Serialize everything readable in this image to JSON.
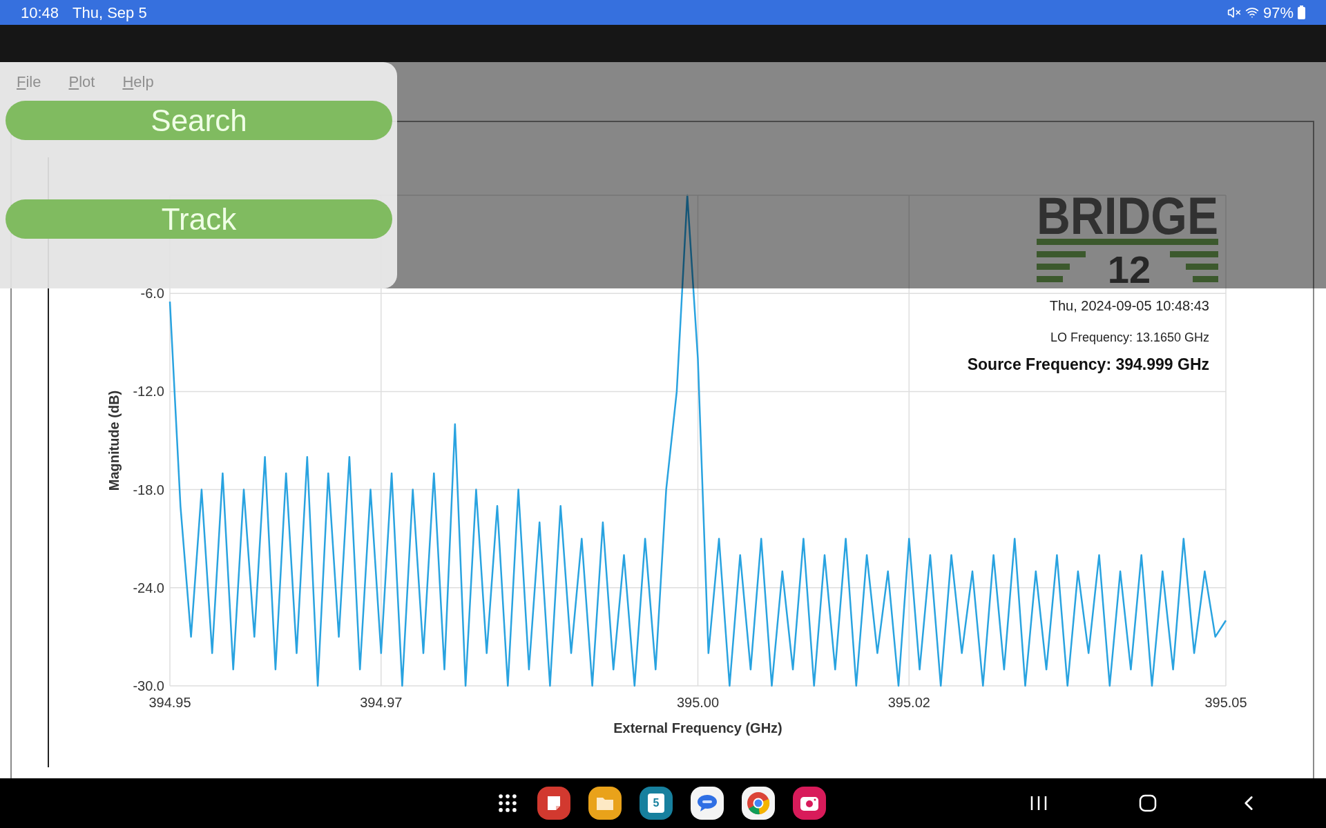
{
  "status_bar": {
    "time": "10:48",
    "date": "Thu, Sep 5",
    "battery": "97%"
  },
  "menu_bar": {
    "items": [
      {
        "label": "File"
      },
      {
        "label": "Plot"
      },
      {
        "label": "Help"
      }
    ]
  },
  "popup": {
    "buttons": [
      {
        "label": "Search"
      },
      {
        "label": "Track"
      }
    ]
  },
  "plot": {
    "logo": {
      "name": "BRIDGE",
      "number": "12"
    },
    "info": {
      "timestamp": "Thu, 2024-09-05 10:48:43",
      "lo_frequency": "LO Frequency: 13.1650 GHz",
      "source_frequency": "Source Frequency: 394.999 GHz"
    },
    "chart_data": {
      "type": "line",
      "grid": true,
      "xlabel": "External Frequency (GHz)",
      "ylabel": "Magnitude (dB)",
      "xlim": [
        394.95,
        395.05
      ],
      "ylim": [
        -30,
        0
      ],
      "x": [
        394.95,
        394.951,
        394.952,
        394.953,
        394.954,
        394.955,
        394.956,
        394.957,
        394.958,
        394.959,
        394.96,
        394.961,
        394.962,
        394.963,
        394.964,
        394.965,
        394.966,
        394.967,
        394.968,
        394.969,
        394.97,
        394.971,
        394.972,
        394.973,
        394.974,
        394.975,
        394.976,
        394.977,
        394.978,
        394.979,
        394.98,
        394.981,
        394.982,
        394.983,
        394.984,
        394.985,
        394.986,
        394.987,
        394.988,
        394.989,
        394.99,
        394.991,
        394.992,
        394.993,
        394.994,
        394.995,
        394.996,
        394.997,
        394.998,
        394.999,
        395.0,
        395.001,
        395.002,
        395.003,
        395.004,
        395.005,
        395.006,
        395.007,
        395.008,
        395.009,
        395.01,
        395.011,
        395.012,
        395.013,
        395.014,
        395.015,
        395.016,
        395.017,
        395.018,
        395.019,
        395.02,
        395.021,
        395.022,
        395.023,
        395.024,
        395.025,
        395.026,
        395.027,
        395.028,
        395.029,
        395.03,
        395.031,
        395.032,
        395.033,
        395.034,
        395.035,
        395.036,
        395.037,
        395.038,
        395.039,
        395.04,
        395.041,
        395.042,
        395.043,
        395.044,
        395.045,
        395.046,
        395.047,
        395.048,
        395.049,
        395.05
      ],
      "xticks": [
        {
          "value": 394.95,
          "label": "394.95"
        },
        {
          "value": 394.97,
          "label": "394.97"
        },
        {
          "value": 395.0,
          "label": "395.00"
        },
        {
          "value": 395.02,
          "label": "395.02"
        },
        {
          "value": 395.05,
          "label": "395.05"
        }
      ],
      "yticks": [
        {
          "value": -6,
          "label": "-6.0"
        },
        {
          "value": -12,
          "label": "-12.0"
        },
        {
          "value": -18,
          "label": "-18.0"
        },
        {
          "value": -24,
          "label": "-24.0"
        },
        {
          "value": -30,
          "label": "-30.0"
        }
      ],
      "series": [
        {
          "color": "#29a3e0",
          "values": [
            -6.5,
            -19,
            -27,
            -18,
            -28,
            -17,
            -29,
            -18,
            -27,
            -16,
            -29,
            -17,
            -28,
            -16,
            -30,
            -17,
            -27,
            -16,
            -29,
            -18,
            -28,
            -17,
            -30,
            -18,
            -28,
            -17,
            -29,
            -14,
            -30,
            -18,
            -28,
            -19,
            -30,
            -18,
            -29,
            -20,
            -30,
            -19,
            -28,
            -21,
            -30,
            -20,
            -29,
            -22,
            -30,
            -21,
            -29,
            -18,
            -12,
            0,
            -10,
            -28,
            -21,
            -30,
            -22,
            -29,
            -21,
            -30,
            -23,
            -29,
            -21,
            -30,
            -22,
            -29,
            -21,
            -30,
            -22,
            -28,
            -23,
            -30,
            -21,
            -29,
            -22,
            -30,
            -22,
            -28,
            -23,
            -30,
            -22,
            -29,
            -21,
            -30,
            -23,
            -29,
            -22,
            -30,
            -23,
            -28,
            -22,
            -30,
            -23,
            -29,
            -22,
            -30,
            -23,
            -29,
            -21,
            -28,
            -23,
            -27,
            -26
          ]
        }
      ]
    }
  },
  "nav_bar": {
    "apps": [
      {
        "kind": "notes"
      },
      {
        "kind": "folder"
      },
      {
        "kind": "calendar",
        "text": "5"
      },
      {
        "kind": "messages"
      },
      {
        "kind": "browser"
      },
      {
        "kind": "camera"
      }
    ]
  }
}
